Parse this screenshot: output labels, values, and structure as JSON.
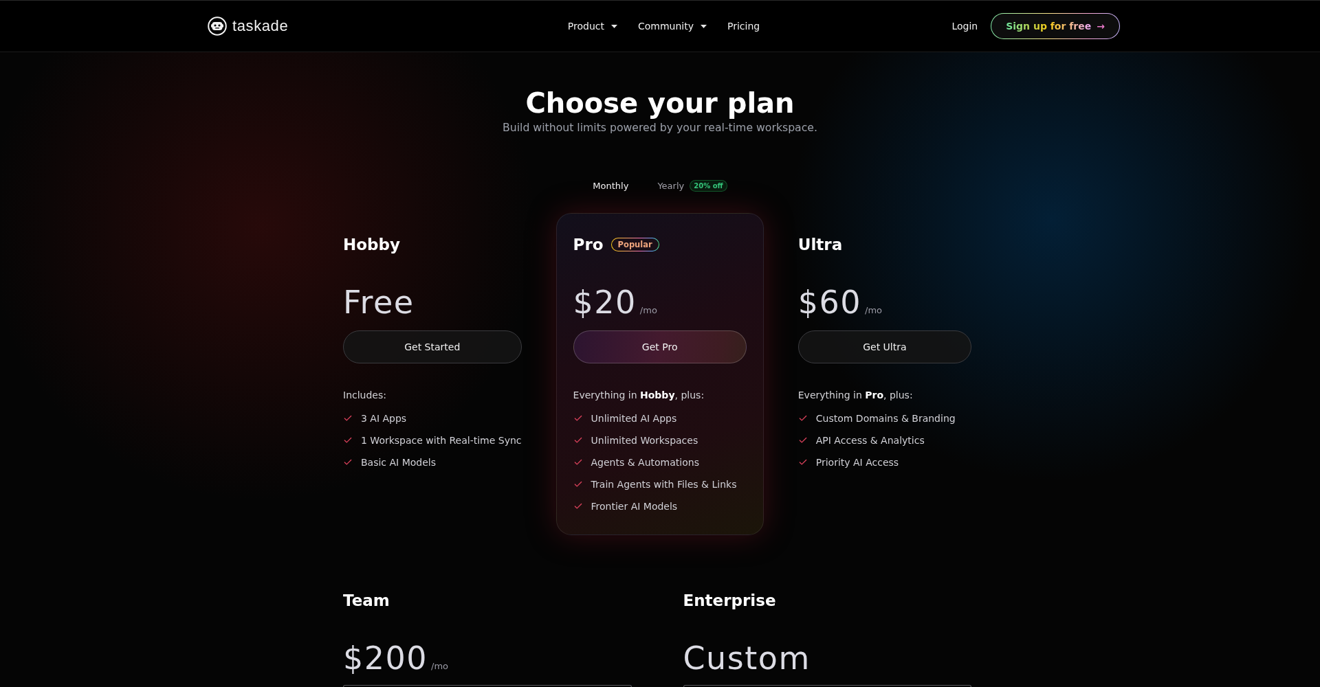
{
  "header": {
    "logo": "taskade",
    "nav": [
      {
        "label": "Product",
        "dropdown": true
      },
      {
        "label": "Community",
        "dropdown": true
      },
      {
        "label": "Pricing",
        "dropdown": false
      }
    ],
    "login": "Login",
    "signup": "Sign up for free",
    "signup_arrow": "→"
  },
  "hero": {
    "title": "Choose your plan",
    "subtitle": "Build without limits powered by your real-time workspace."
  },
  "billing": [
    {
      "label": "Monthly",
      "selected": true
    },
    {
      "label": "Yearly",
      "selected": false,
      "badge": "20% off"
    }
  ],
  "plans": [
    {
      "name": "Hobby",
      "featured": false,
      "price": "Free",
      "cta": "Get Started",
      "intro": "Includes:",
      "features": [
        "3 AI Apps",
        "1 Workspace with Real-time Sync",
        "Basic AI Models"
      ]
    },
    {
      "name": "Pro",
      "badge": "Popular",
      "featured": true,
      "price": "$20",
      "period": "/mo",
      "cta": "Get Pro",
      "intro": "Everything in **Hobby**, plus:",
      "features": [
        "Unlimited AI Apps",
        "Unlimited Workspaces",
        "Agents & Automations",
        "Train Agents with Files & Links",
        "Frontier AI Models"
      ]
    },
    {
      "name": "Ultra",
      "featured": false,
      "price": "$60",
      "period": "/mo",
      "cta": "Get Ultra",
      "intro": "Everything in **Pro**, plus:",
      "features": [
        "Custom Domains & Branding",
        "API Access & Analytics",
        "Priority AI Access"
      ]
    }
  ],
  "more_plans": [
    {
      "name": "Team",
      "price": "$200",
      "period": "/mo"
    },
    {
      "name": "Enterprise",
      "price": "Custom"
    }
  ]
}
